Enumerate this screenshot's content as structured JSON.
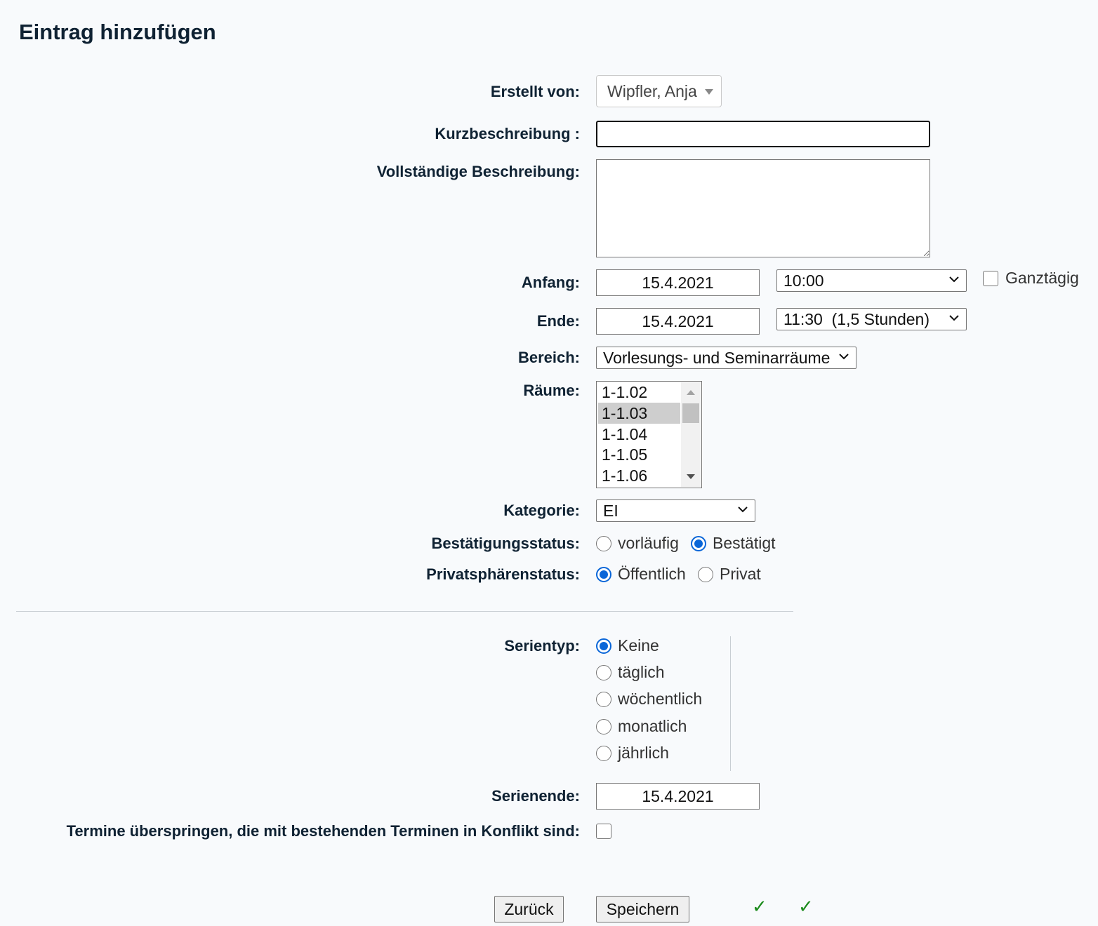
{
  "page": {
    "title": "Eintrag hinzufügen"
  },
  "form": {
    "created_by": {
      "label": "Erstellt von:",
      "value": "Wipfler, Anja"
    },
    "short_desc": {
      "label": "Kurzbeschreibung :",
      "value": ""
    },
    "full_desc": {
      "label": "Vollständige Beschreibung:",
      "value": ""
    },
    "start": {
      "label": "Anfang:",
      "date": "15.4.2021",
      "time": "10:00",
      "allday_label": "Ganztägig",
      "allday_checked": false
    },
    "end": {
      "label": "Ende:",
      "date": "15.4.2021",
      "time": "11:30  (1,5 Stunden)"
    },
    "area": {
      "label": "Bereich:",
      "value": "Vorlesungs- und Seminarräume"
    },
    "rooms": {
      "label": "Räume:",
      "options": [
        "1-1.02",
        "1-1.03",
        "1-1.04",
        "1-1.05",
        "1-1.06"
      ],
      "selected": "1-1.03"
    },
    "category": {
      "label": "Kategorie:",
      "value": "EI"
    },
    "confirmation": {
      "label": "Bestätigungsstatus:",
      "options": [
        "vorläufig",
        "Bestätigt"
      ],
      "selected": "Bestätigt"
    },
    "privacy": {
      "label": "Privatsphärenstatus:",
      "options": [
        "Öffentlich",
        "Privat"
      ],
      "selected": "Öffentlich"
    }
  },
  "repeat": {
    "type_label": "Serientyp:",
    "types": [
      "Keine",
      "täglich",
      "wöchentlich",
      "monatlich",
      "jährlich"
    ],
    "selected": "Keine",
    "end_label": "Serienende:",
    "end_date": "15.4.2021",
    "skip_label": "Termine überspringen, die mit bestehenden Terminen in Konflikt sind:",
    "skip_checked": false
  },
  "buttons": {
    "back": "Zurück",
    "save": "Speichern"
  },
  "status_checks": [
    "✓",
    "✓"
  ],
  "colors": {
    "accent": "#0a66d8",
    "check": "#1a8a1a",
    "text": "#0f2233"
  }
}
